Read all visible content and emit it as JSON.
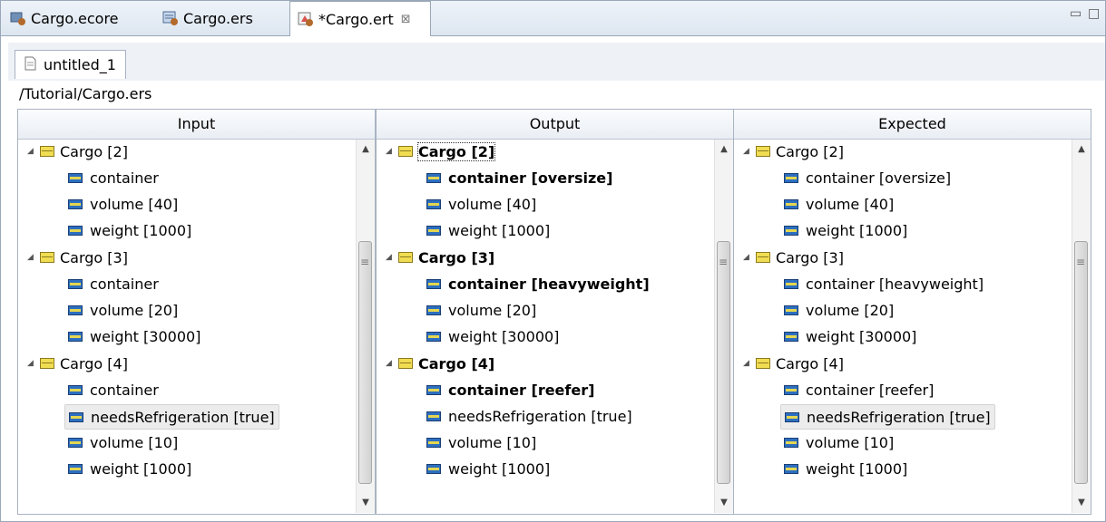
{
  "editor_tabs": [
    {
      "label": "Cargo.ecore"
    },
    {
      "label": "Cargo.ers"
    },
    {
      "label": "*Cargo.ert",
      "close": "⊠"
    }
  ],
  "window_controls": {
    "minimize": "▭",
    "maximize": "□"
  },
  "subtab": {
    "label": "untitled_1"
  },
  "path": "/Tutorial/Cargo.ers",
  "panels": [
    {
      "header": "Input",
      "rows": [
        "Cargo [2]",
        "container",
        "volume [40]",
        "weight [1000]",
        "Cargo [3]",
        "container",
        "volume [20]",
        "weight [30000]",
        "Cargo [4]",
        "container",
        "needsRefrigeration [true]",
        "volume [10]",
        "weight [1000]"
      ]
    },
    {
      "header": "Output",
      "rows": [
        "Cargo [2]",
        "container [oversize]",
        "volume [40]",
        "weight [1000]",
        "Cargo [3]",
        "container [heavyweight]",
        "volume [20]",
        "weight [30000]",
        "Cargo [4]",
        "container [reefer]",
        "needsRefrigeration [true]",
        "volume [10]",
        "weight [1000]"
      ]
    },
    {
      "header": "Expected",
      "rows": [
        "Cargo [2]",
        "container [oversize]",
        "volume [40]",
        "weight [1000]",
        "Cargo [3]",
        "container [heavyweight]",
        "volume [20]",
        "weight [30000]",
        "Cargo [4]",
        "container [reefer]",
        "needsRefrigeration [true]",
        "volume [10]",
        "weight [1000]"
      ]
    }
  ],
  "scrollbar": {
    "up": "▲",
    "down": "▼",
    "grip": "≡"
  }
}
